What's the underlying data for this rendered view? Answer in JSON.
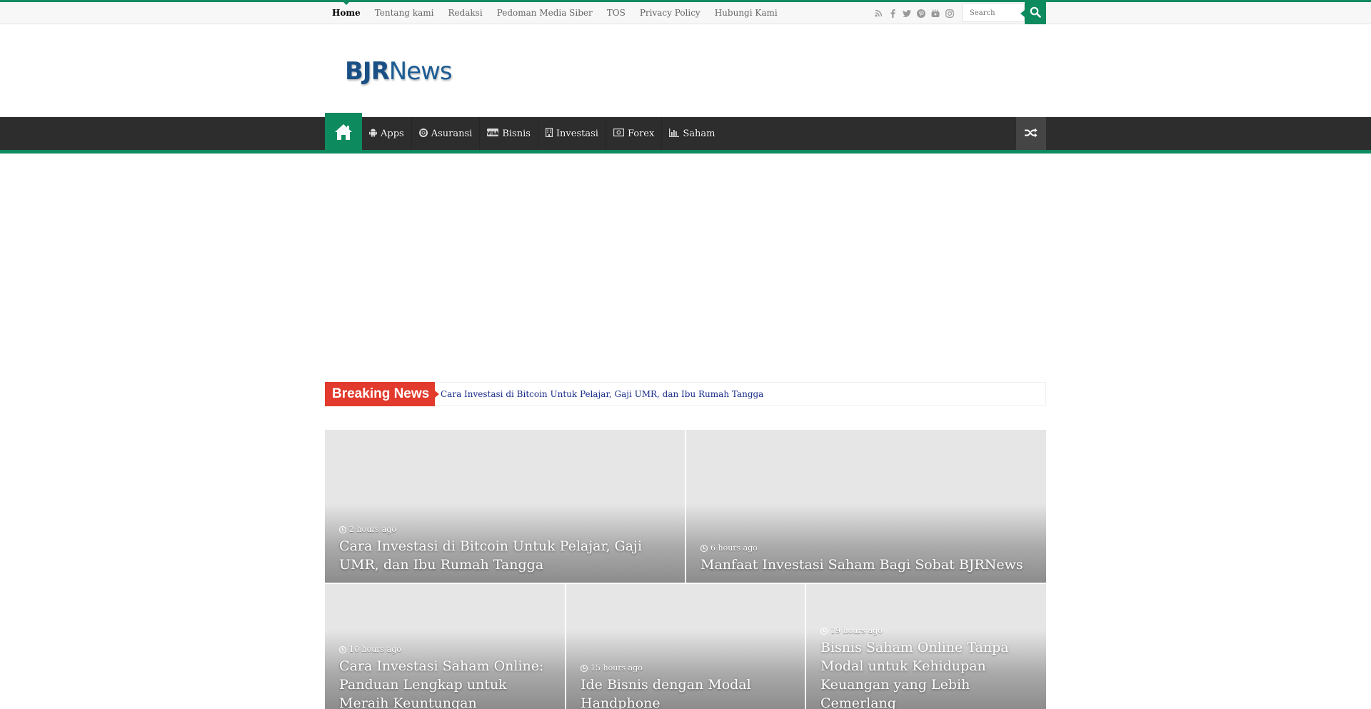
{
  "top_nav": {
    "items": [
      "Home",
      "Tentang kami",
      "Redaksi",
      "Pedoman Media Siber",
      "TOS",
      "Privacy Policy",
      "Hubungi Kami"
    ]
  },
  "social": {
    "icons": [
      "rss-icon",
      "facebook-icon",
      "twitter-icon",
      "pinterest-icon",
      "youtube-icon",
      "instagram-icon"
    ]
  },
  "search": {
    "placeholder": "Search"
  },
  "logo": {
    "part1": "BJR",
    "part2": "News"
  },
  "main_nav": {
    "items": [
      {
        "label": "Apps",
        "icon": "android-icon"
      },
      {
        "label": "Asuransi",
        "icon": "life-ring-icon"
      },
      {
        "label": "Bisnis",
        "icon": "visa-card-icon"
      },
      {
        "label": "Investasi",
        "icon": "building-icon"
      },
      {
        "label": "Forex",
        "icon": "money-icon"
      },
      {
        "label": "Saham",
        "icon": "bar-chart-icon"
      }
    ]
  },
  "breaking": {
    "label": "Breaking News",
    "headline": "Cara Investasi di Bitcoin Untuk Pelajar, Gaji UMR, dan Ibu Rumah Tangga"
  },
  "featured": [
    {
      "time": "2 hours ago",
      "title": "Cara Investasi di Bitcoin Untuk Pelajar, Gaji UMR, dan Ibu Rumah Tangga"
    },
    {
      "time": "6 hours ago",
      "title": "Manfaat Investasi Saham Bagi Sobat BJRNews"
    },
    {
      "time": "10 hours ago",
      "title": "Cara Investasi Saham Online: Panduan Lengkap untuk Meraih Keuntungan"
    },
    {
      "time": "15 hours ago",
      "title": "Ide Bisnis dengan Modal Handphone"
    },
    {
      "time": "19 hours ago",
      "title": "Bisnis Saham Online Tanpa Modal untuk Kehidupan Keuangan yang Lebih Cemerlang"
    }
  ],
  "colors": {
    "accent": "#0e8a5f",
    "breaking": "#e23a2c",
    "nav_bg": "#2d2d2d"
  }
}
